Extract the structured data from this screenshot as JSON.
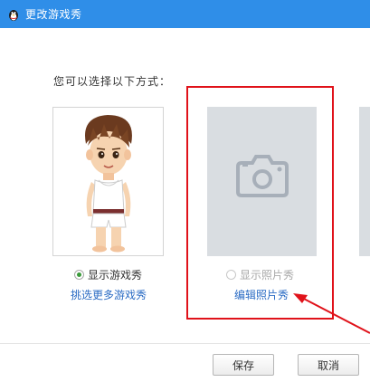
{
  "window": {
    "title": "更改游戏秀"
  },
  "prompt": "您可以选择以下方式：",
  "options": {
    "avatar": {
      "radio_label": "显示游戏秀",
      "checked": true,
      "link": "挑选更多游戏秀"
    },
    "photo": {
      "radio_label": "显示照片秀",
      "checked": false,
      "link": "编辑照片秀"
    }
  },
  "buttons": {
    "save": "保存",
    "cancel": "取消"
  },
  "colors": {
    "titlebar": "#2f8ee8",
    "highlight_box": "#e0121a",
    "link": "#2b6cc4",
    "placeholder": "#d9dde1"
  }
}
